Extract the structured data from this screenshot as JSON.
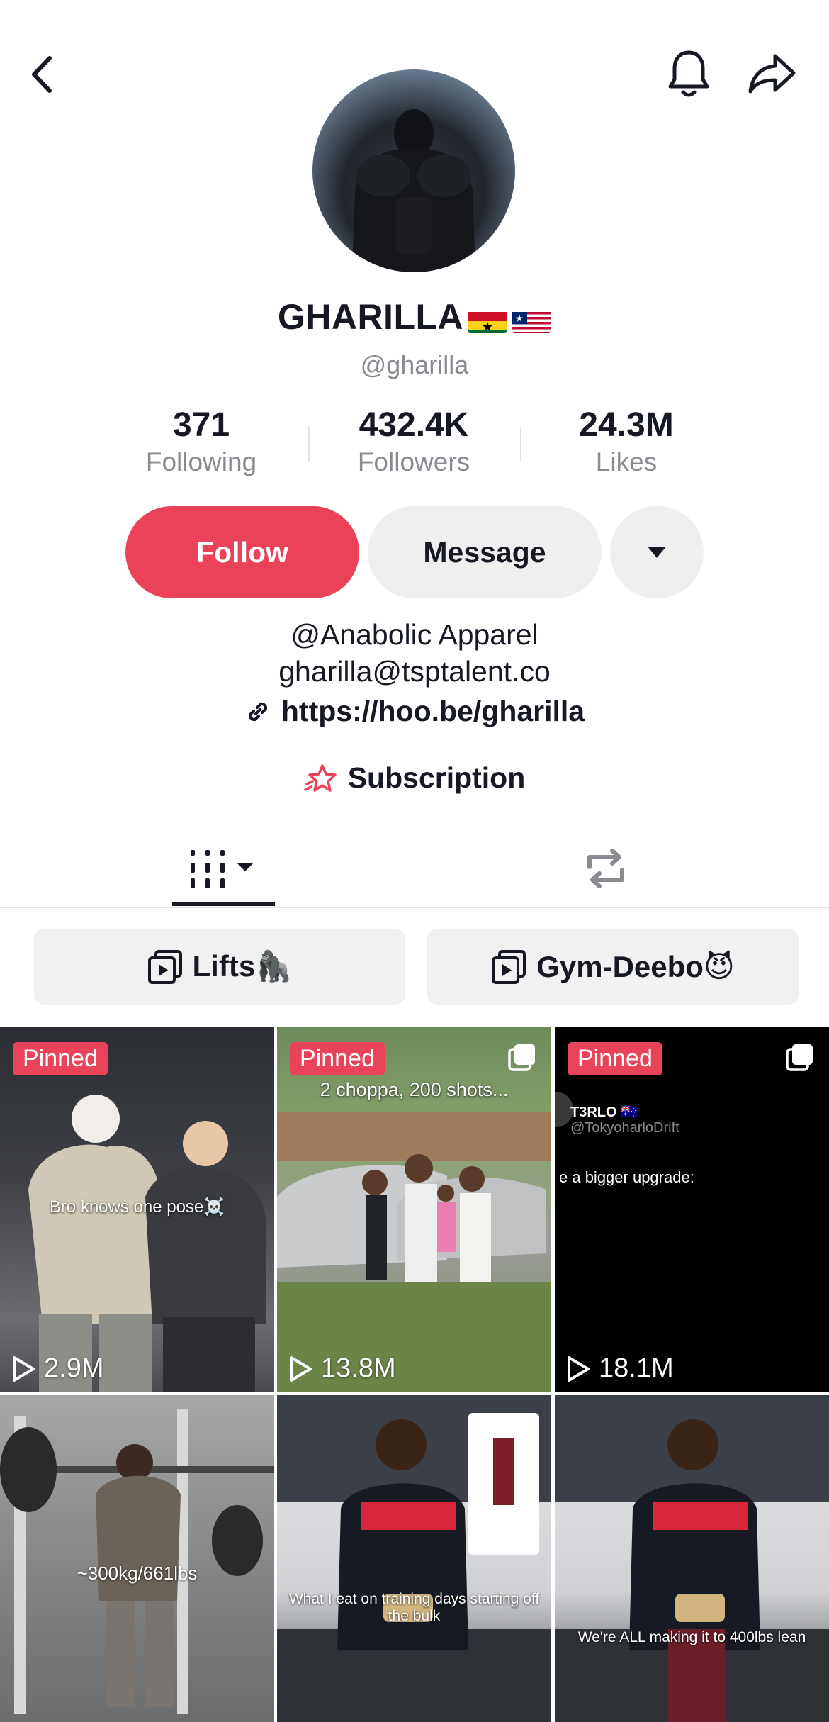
{
  "header": {
    "back_icon": "chevron-left-icon",
    "bell_icon": "bell-icon",
    "share_icon": "share-arrow-icon"
  },
  "profile": {
    "display_name": "GHARILLA",
    "flags": [
      "Ghana",
      "Liberia"
    ],
    "handle": "@gharilla"
  },
  "stats": [
    {
      "value": "371",
      "label": "Following"
    },
    {
      "value": "432.4K",
      "label": "Followers"
    },
    {
      "value": "24.3M",
      "label": "Likes"
    }
  ],
  "actions": {
    "follow_label": "Follow",
    "message_label": "Message"
  },
  "bio": {
    "line1": "@Anabolic Apparel",
    "line2": "gharilla@tsptalent.co",
    "link": "https://hoo.be/gharilla",
    "subscription": "Subscription"
  },
  "tabs": [
    "videos-grid",
    "reposts"
  ],
  "playlists": [
    {
      "label": "Lifts🦍"
    },
    {
      "label": "Gym-Deebo😈"
    }
  ],
  "videos": [
    {
      "pinned": "Pinned",
      "views": "2.9M",
      "caption": "Bro knows one pose☠️"
    },
    {
      "pinned": "Pinned",
      "views": "13.8M",
      "caption": "2 choppa, 200 shots..."
    },
    {
      "pinned": "Pinned",
      "views": "18.1M",
      "caption": "e a bigger upgrade:",
      "tweet_name": "T3RLO 🇦🇺",
      "tweet_handle": "@TokyoharloDrift"
    },
    {
      "caption": "~300kg/661lbs"
    },
    {
      "caption": "What I eat on training days starting off the bulk"
    },
    {
      "caption": "We're ALL making it to 400lbs lean"
    }
  ],
  "colors": {
    "accent": "#ea4359",
    "text": "#161823",
    "muted": "#8a8b91",
    "chip_bg": "#efeff0"
  }
}
